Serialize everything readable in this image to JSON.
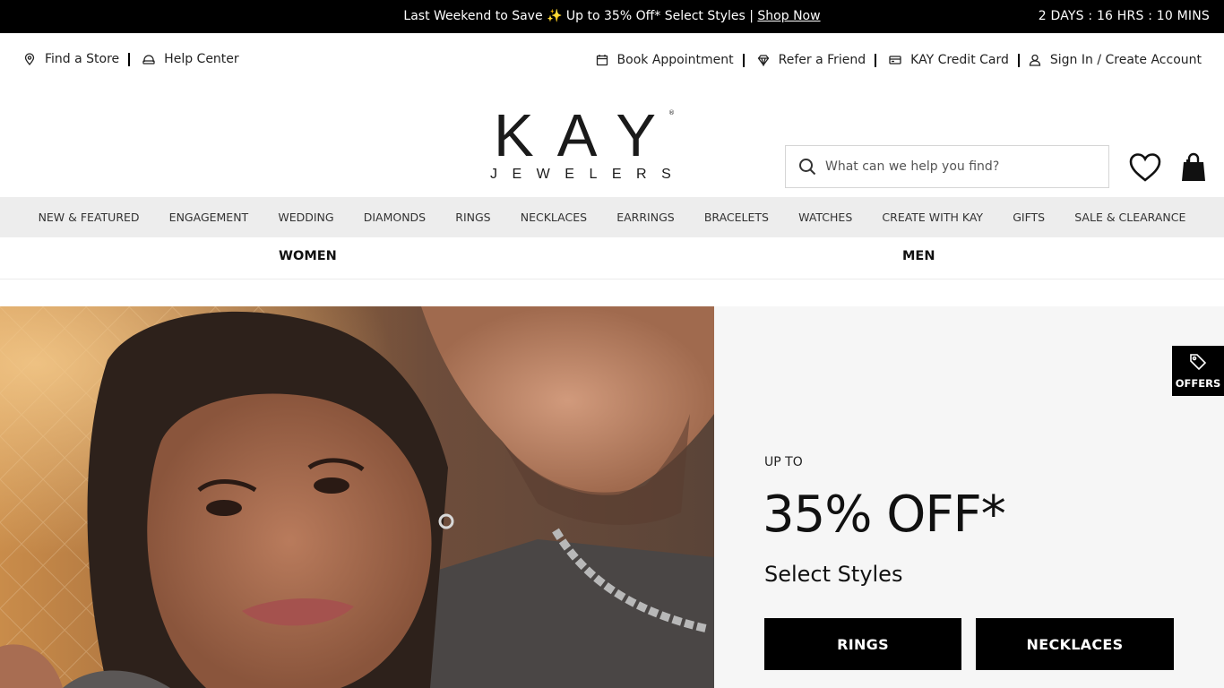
{
  "promo": {
    "message_prefix": "Last Weekend to Save ✨ Up to 35% Off* Select Styles | ",
    "link": "Shop Now",
    "timer": "2 DAYS : 16 HRS : 10 MINS"
  },
  "utility": {
    "left": [
      {
        "label": "Find a Store",
        "icon": "map-pin-icon"
      },
      {
        "label": "Help Center",
        "icon": "headset-icon"
      }
    ],
    "right": [
      {
        "label": "Book Appointment",
        "icon": "calendar-icon"
      },
      {
        "label": "Refer a Friend",
        "icon": "diamond-icon"
      },
      {
        "label": "KAY Credit Card",
        "icon": "credit-card-icon"
      },
      {
        "label": "Sign In / Create Account",
        "icon": "user-icon"
      }
    ]
  },
  "logo": {
    "line1": "KAY",
    "line2": "JEWELERS",
    "mark": "®"
  },
  "search": {
    "placeholder": "What can we help you find?",
    "value": ""
  },
  "nav": {
    "items": [
      "NEW & FEATURED",
      "ENGAGEMENT",
      "WEDDING",
      "DIAMONDS",
      "RINGS",
      "NECKLACES",
      "EARRINGS",
      "BRACELETS",
      "WATCHES",
      "CREATE WITH KAY",
      "GIFTS",
      "SALE & CLEARANCE"
    ]
  },
  "gender": {
    "women": "WOMEN",
    "men": "MEN"
  },
  "hero": {
    "eyebrow": "UP TO",
    "headline": "35% OFF*",
    "subhead": "Select Styles",
    "cta_rings": "RINGS",
    "cta_necklaces": "NECKLACES"
  },
  "offers": {
    "label": "OFFERS",
    "icon": "tag-icon"
  },
  "colors": {
    "promo_bg": "#000000",
    "nav_bg": "#ededed",
    "hero_panel_bg": "#f6f6f6",
    "cta_bg": "#000000"
  }
}
